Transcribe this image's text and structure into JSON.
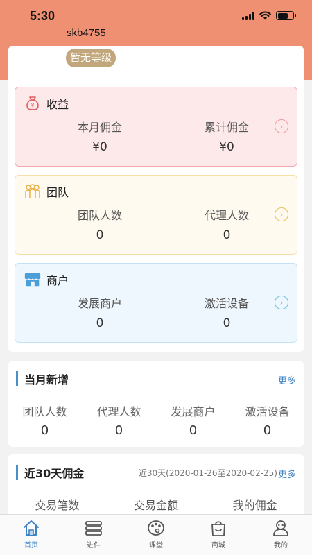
{
  "status": {
    "time": "5:30"
  },
  "profile": {
    "username": "skb4755",
    "level": "暂无等级"
  },
  "cards": {
    "income": {
      "title": "收益",
      "left_label": "本月佣金",
      "left_value": "¥0",
      "right_label": "累计佣金",
      "right_value": "¥0"
    },
    "team": {
      "title": "团队",
      "left_label": "团队人数",
      "left_value": "0",
      "right_label": "代理人数",
      "right_value": "0"
    },
    "merchant": {
      "title": "商户",
      "left_label": "发展商户",
      "left_value": "0",
      "right_label": "激活设备",
      "right_value": "0"
    }
  },
  "monthly_new": {
    "title": "当月新增",
    "more": "更多",
    "items": [
      {
        "label": "团队人数",
        "value": "0"
      },
      {
        "label": "代理人数",
        "value": "0"
      },
      {
        "label": "发展商户",
        "value": "0"
      },
      {
        "label": "激活设备",
        "value": "0"
      }
    ]
  },
  "commission_30": {
    "title": "近30天佣金",
    "range": "近30天(2020-01-26至2020-02-25)",
    "more": "更多",
    "columns": [
      "交易笔数",
      "交易金额",
      "我的佣金"
    ]
  },
  "tabbar": [
    {
      "label": "首页",
      "icon": "home-icon",
      "active": true
    },
    {
      "label": "进件",
      "icon": "list-icon",
      "active": false
    },
    {
      "label": "课堂",
      "icon": "palette-icon",
      "active": false
    },
    {
      "label": "商城",
      "icon": "shopping-bag-icon",
      "active": false
    },
    {
      "label": "我的",
      "icon": "user-icon",
      "active": false
    }
  ],
  "colors": {
    "header": "#ef9072",
    "accent": "#3b82c4",
    "badge": "#c2a77d"
  }
}
